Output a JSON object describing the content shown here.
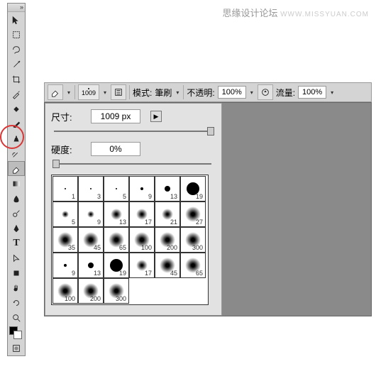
{
  "watermark": {
    "cn": "思缘设计论坛",
    "en": "WWW.MISSYUAN.COM"
  },
  "toolbar": {
    "tools": [
      "move",
      "rect-marquee",
      "lasso",
      "magic-wand",
      "crop",
      "eyedropper",
      "spot-heal",
      "brush",
      "clone-stamp",
      "history-brush",
      "eraser",
      "gradient",
      "blur",
      "dodge",
      "pen",
      "type",
      "path-select",
      "rectangle",
      "hand",
      "zoom",
      "rotate"
    ],
    "fg": "#000000",
    "bg": "#ffffff"
  },
  "options": {
    "brush_size": "1009",
    "mode_label": "模式:",
    "mode_value": "筆刷",
    "opacity_label": "不透明:",
    "opacity_value": "100%",
    "flow_label": "流量:",
    "flow_value": "100%"
  },
  "brushPanel": {
    "size_label": "尺寸:",
    "size_value": "1009 px",
    "hardness_label": "硬度:",
    "hardness_value": "0%",
    "presets": [
      {
        "label": "1",
        "shape": "dot-xs"
      },
      {
        "label": "3",
        "shape": "dot-xs"
      },
      {
        "label": "5",
        "shape": "dot-xs"
      },
      {
        "label": "9",
        "shape": "dot-s"
      },
      {
        "label": "13",
        "shape": "dot-m"
      },
      {
        "label": "19",
        "shape": "dot-xl"
      },
      {
        "label": "5",
        "shape": "soft-s"
      },
      {
        "label": "9",
        "shape": "soft-s"
      },
      {
        "label": "13",
        "shape": "soft-m"
      },
      {
        "label": "17",
        "shape": "soft-m"
      },
      {
        "label": "21",
        "shape": "soft-m"
      },
      {
        "label": "27",
        "shape": "soft-l"
      },
      {
        "label": "35",
        "shape": "soft-l"
      },
      {
        "label": "45",
        "shape": "soft-l"
      },
      {
        "label": "65",
        "shape": "soft-l"
      },
      {
        "label": "100",
        "shape": "soft-l"
      },
      {
        "label": "200",
        "shape": "soft-l"
      },
      {
        "label": "300",
        "shape": "soft-l"
      },
      {
        "label": "9",
        "shape": "dot-s"
      },
      {
        "label": "13",
        "shape": "dot-m"
      },
      {
        "label": "19",
        "shape": "dot-xl"
      },
      {
        "label": "17",
        "shape": "soft-m"
      },
      {
        "label": "45",
        "shape": "soft-l"
      },
      {
        "label": "65",
        "shape": "soft-l"
      },
      {
        "label": "100",
        "shape": "soft-l"
      },
      {
        "label": "200",
        "shape": "soft-l"
      },
      {
        "label": "300",
        "shape": "soft-l"
      }
    ]
  }
}
